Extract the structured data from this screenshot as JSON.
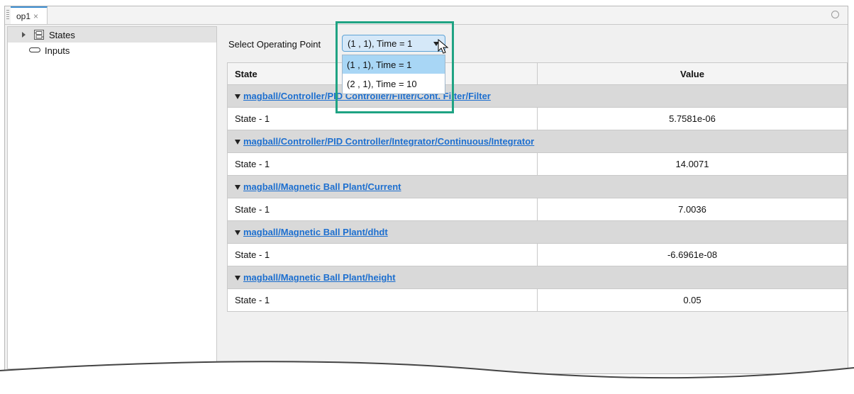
{
  "tab": {
    "title": "op1",
    "close": "×"
  },
  "sidebar": {
    "items": [
      {
        "label": "States"
      },
      {
        "label": "Inputs"
      }
    ]
  },
  "operating_point": {
    "label": "Select Operating Point",
    "selected": "(1 , 1), Time = 1",
    "options": [
      "(1 , 1), Time = 1",
      "(2 , 1), Time = 10"
    ]
  },
  "table": {
    "headers": {
      "state": "State",
      "value": "Value"
    },
    "groups": [
      {
        "path": "magball/Controller/PID Controller/Filter/Cont. Filter/Filter",
        "state": "State - 1",
        "value": "5.7581e-06"
      },
      {
        "path": "magball/Controller/PID Controller/Integrator/Continuous/Integrator",
        "state": "State - 1",
        "value": "14.0071"
      },
      {
        "path": "magball/Magnetic Ball Plant/Current",
        "state": "State - 1",
        "value": "7.0036"
      },
      {
        "path": "magball/Magnetic Ball Plant/dhdt",
        "state": "State - 1",
        "value": "-6.6961e-08"
      },
      {
        "path": "magball/Magnetic Ball Plant/height",
        "state": "State - 1",
        "value": "0.05"
      }
    ]
  },
  "colors": {
    "highlight": "#1fa383",
    "link": "#1d6fcf",
    "selected_option": "#a8d6f5"
  }
}
